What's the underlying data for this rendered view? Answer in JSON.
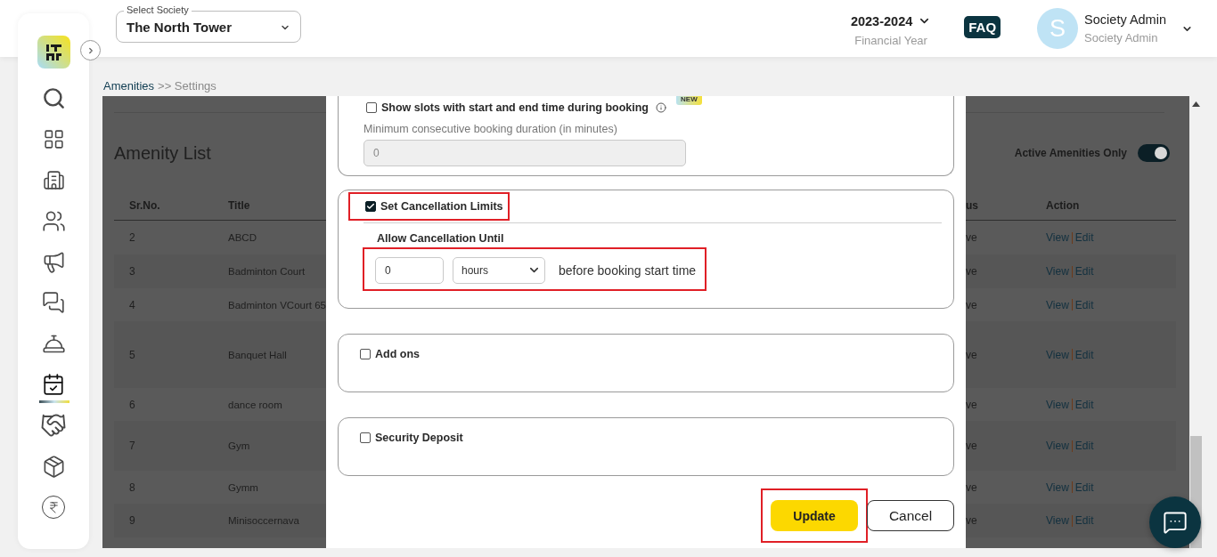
{
  "header": {
    "society_select": {
      "label": "Select Society",
      "value": "The North Tower"
    },
    "financial_year": {
      "value": "2023-2024",
      "label": "Financial Year"
    },
    "faq": "FAQ",
    "user": {
      "initial": "S",
      "name": "Society Admin",
      "role": "Society Admin"
    }
  },
  "sidebar": {
    "items": [
      {
        "selected": false
      },
      {
        "selected": false
      },
      {
        "selected": false
      },
      {
        "selected": false
      },
      {
        "selected": false
      },
      {
        "selected": false
      },
      {
        "selected": false
      },
      {
        "selected": true
      },
      {
        "selected": false
      },
      {
        "selected": false
      },
      {
        "selected": false
      }
    ]
  },
  "breadcrumb": {
    "link": "Amenities",
    "current": ">> Settings"
  },
  "amenity_list": {
    "title": "Amenity List",
    "toggle": {
      "label": "Active Amenities Only",
      "on": true
    },
    "columns": [
      "Sr.No.",
      "Title",
      "us",
      "Action"
    ],
    "rows": [
      {
        "sr_no": "2",
        "title": "ABCD",
        "status": "ve",
        "actions": [
          "View",
          "Edit"
        ]
      },
      {
        "sr_no": "3",
        "title": "Badminton Court",
        "status": "ve",
        "actions": [
          "View",
          "Edit"
        ]
      },
      {
        "sr_no": "4",
        "title": "Badminton VCourt 65",
        "status": "ve",
        "actions": [
          "View",
          "Edit"
        ]
      },
      {
        "sr_no": "5",
        "title": "Banquet Hall",
        "status": "ve",
        "actions": [
          "View",
          "Edit"
        ]
      },
      {
        "sr_no": "6",
        "title": "dance room",
        "status": "ve",
        "actions": [
          "View",
          "Edit"
        ]
      },
      {
        "sr_no": "7",
        "title": "Gym",
        "status": "ve",
        "actions": [
          "View",
          "Edit"
        ]
      },
      {
        "sr_no": "8",
        "title": "Gymm",
        "status": "ve",
        "actions": [
          "View",
          "Edit"
        ]
      },
      {
        "sr_no": "9",
        "title": "Minisoccernava",
        "status": "ve",
        "actions": [
          "View",
          "Edit"
        ]
      }
    ]
  },
  "modal": {
    "sections": [
      {
        "kind": "slots",
        "label": "Show slots with start and end time during booking",
        "checked": false,
        "badge": "NEW",
        "field_label": "Minimum consecutive booking duration (in minutes)",
        "field_value": "0",
        "disabled": true
      },
      {
        "kind": "cancellation",
        "label": "Set Cancellation Limits",
        "checked": true,
        "highlighted": true,
        "subtitle": "Allow Cancellation Until",
        "amount": "0",
        "unit": "hours",
        "suffix": "before booking start time",
        "row_highlighted": true
      },
      {
        "kind": "checkbox",
        "label": "Add ons",
        "checked": false
      },
      {
        "kind": "checkbox",
        "label": "Security Deposit",
        "checked": false
      }
    ],
    "buttons": [
      {
        "label": "Update",
        "kind": "primary",
        "highlighted": true
      },
      {
        "label": "Cancel",
        "kind": "secondary",
        "highlighted": false
      }
    ]
  }
}
